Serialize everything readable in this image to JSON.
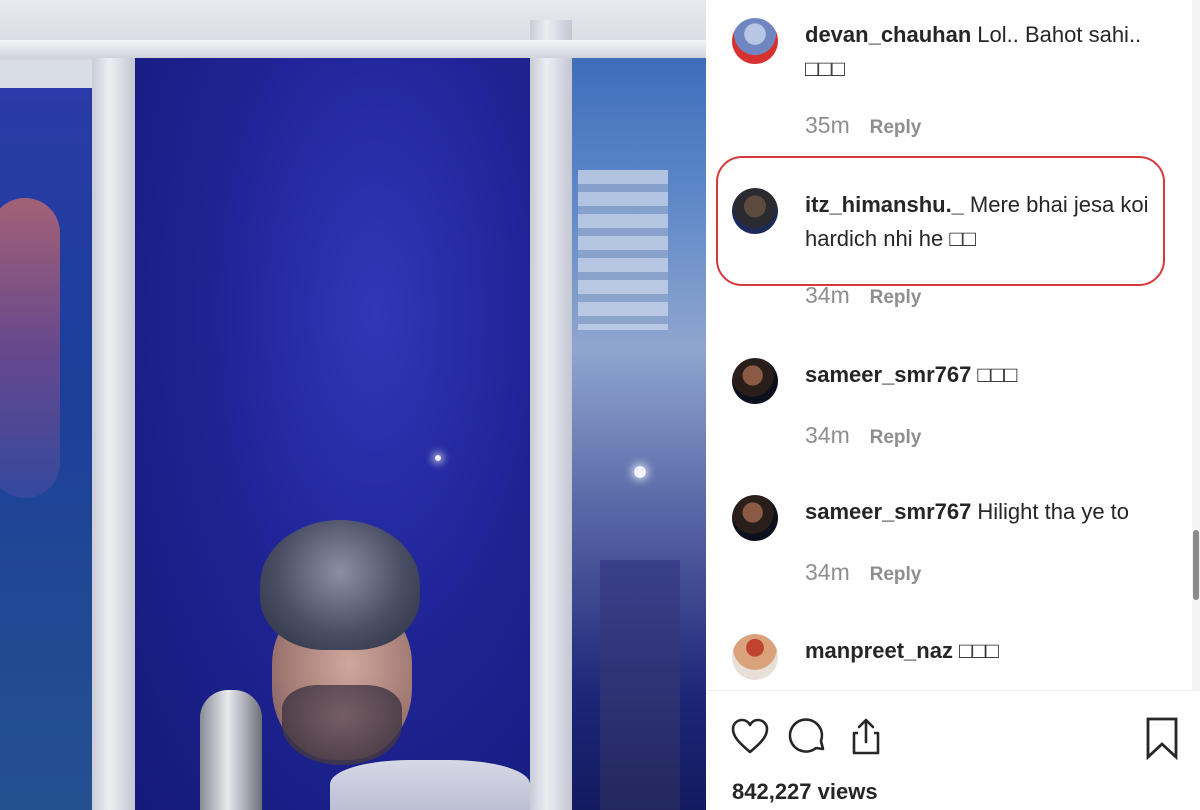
{
  "comments": [
    {
      "username": "devan_chauhan",
      "text": "Lol.. Bahot sahi.. □□□",
      "time": "35m",
      "reply": "Reply"
    },
    {
      "username": "itz_himanshu._",
      "text": "Mere bhai jesa koi hardich nhi he □□",
      "time": "34m",
      "reply": "Reply"
    },
    {
      "username": "sameer_smr767",
      "text": "□□□",
      "time": "34m",
      "reply": "Reply"
    },
    {
      "username": "sameer_smr767",
      "text": "Hilight tha ye to",
      "time": "34m",
      "reply": "Reply"
    },
    {
      "username": "manpreet_naz",
      "text": "□□□"
    }
  ],
  "actions": {
    "like_icon": "heart-outline-icon",
    "comment_icon": "speech-bubble-icon",
    "share_icon": "share-upload-icon",
    "save_icon": "bookmark-outline-icon"
  },
  "views": "842,227 views",
  "colors": {
    "highlight_border": "#d8383a",
    "text_primary": "#262626",
    "text_secondary": "#8e8e8e"
  }
}
